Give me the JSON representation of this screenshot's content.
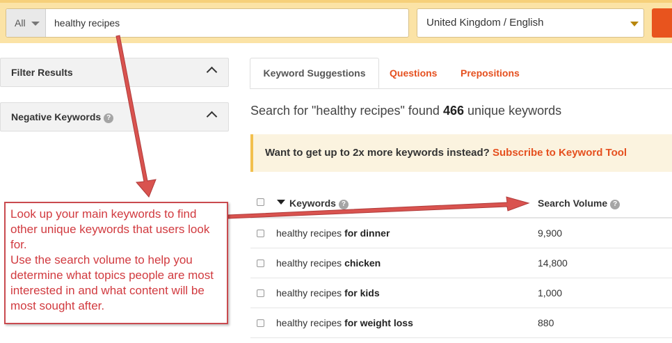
{
  "search": {
    "scope": "All",
    "query": "healthy recipes",
    "locale": "United Kingdom / English"
  },
  "sidebar": {
    "panels": [
      {
        "title": "Filter Results",
        "help": false
      },
      {
        "title": "Negative Keywords",
        "help": true
      }
    ]
  },
  "tabs": [
    {
      "label": "Keyword Suggestions",
      "active": true
    },
    {
      "label": "Questions",
      "active": false
    },
    {
      "label": "Prepositions",
      "active": false
    }
  ],
  "results": {
    "found_prefix": "Search for \"healthy recipes\" found",
    "count": "466",
    "found_suffix": "unique keywords"
  },
  "promo": {
    "text": "Want to get up to 2x more keywords instead?",
    "link": "Subscribe to Keyword Tool"
  },
  "table": {
    "columns": [
      "Keywords",
      "Search Volume"
    ],
    "rows": [
      {
        "base": "healthy recipes",
        "suffix": "for dinner",
        "volume": "9,900"
      },
      {
        "base": "healthy recipes",
        "suffix": "chicken",
        "volume": "14,800"
      },
      {
        "base": "healthy recipes",
        "suffix": "for kids",
        "volume": "1,000"
      },
      {
        "base": "healthy recipes",
        "suffix": "for weight loss",
        "volume": "880"
      }
    ]
  },
  "annotation": {
    "text": "Look up your main keywords to find other unique keywords that users look for.\nUse the search volume to help you determine what topics people are most interested in and what content will be most sought after."
  },
  "colors": {
    "topbar": "#fbe3a6",
    "accent": "#e5501f",
    "callout": "#d13a3f"
  },
  "icons": {
    "help": "question-circle-icon",
    "collapse": "chevron-up-icon",
    "dropdown": "caret-down-icon",
    "sort": "sort-desc-icon"
  }
}
